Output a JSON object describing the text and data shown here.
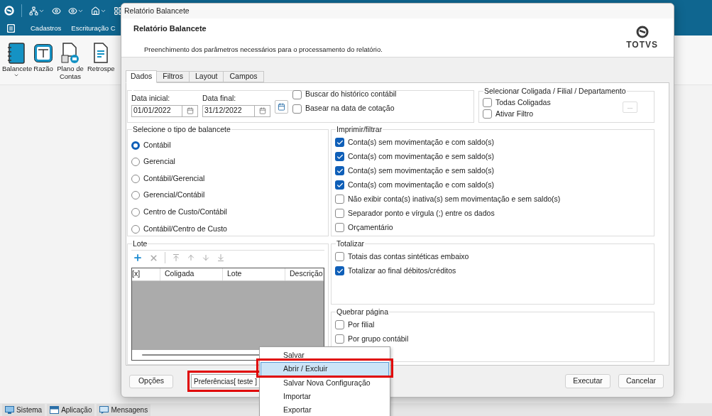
{
  "app": {
    "menu_items": [
      "Cadastros",
      "Escrituração C"
    ],
    "ribbon": [
      {
        "label": "Balancete",
        "kind": "book",
        "dropdown": true
      },
      {
        "label": "Razão",
        "kind": "ledger",
        "dropdown": false
      },
      {
        "label": "Plano de Contas",
        "kind": "chart",
        "dropdown": false
      },
      {
        "label": "Retrospe",
        "kind": "report",
        "dropdown": false
      }
    ],
    "status_tabs": [
      {
        "label": "Sistema",
        "kind": "monitor"
      },
      {
        "label": "Aplicação",
        "kind": "window"
      },
      {
        "label": "Mensagens",
        "kind": "message"
      }
    ]
  },
  "dialog": {
    "window_title": "Relatório Balancete",
    "header": {
      "title": "Relatório Balancete",
      "subtitle": "Preenchimento dos parâmetros necessários para o processamento do relatório.",
      "logo_text": "TOTVS"
    },
    "tabs": [
      {
        "label": "Dados",
        "selected": true
      },
      {
        "label": "Filtros",
        "selected": false
      },
      {
        "label": "Layout",
        "selected": false
      },
      {
        "label": "Campos",
        "selected": false
      }
    ],
    "period": {
      "start_label": "Data inicial:",
      "start_value": "01/01/2022",
      "end_label": "Data final:",
      "end_value": "31/12/2022",
      "options": [
        {
          "label": "Buscar do histórico contábil",
          "checked": false
        },
        {
          "label": "Basear na data de cotação",
          "checked": false
        }
      ]
    },
    "company_filter": {
      "title": "Selecionar Coligada / Filial / Departamento",
      "browse_button": "...",
      "options": [
        {
          "label": "Todas Coligadas",
          "checked": false
        },
        {
          "label": "Ativar Filtro",
          "checked": false
        }
      ]
    },
    "balance_type": {
      "title": "Selecione o tipo de balancete",
      "options": [
        {
          "label": "Contábil",
          "selected": true
        },
        {
          "label": "Gerencial",
          "selected": false
        },
        {
          "label": "Contábil/Gerencial",
          "selected": false
        },
        {
          "label": "Gerencial/Contábil",
          "selected": false
        },
        {
          "label": "Centro de Custo/Contábil",
          "selected": false
        },
        {
          "label": "Contábil/Centro de Custo",
          "selected": false
        }
      ]
    },
    "print_filter": {
      "title": "Imprimir/filtrar",
      "options": [
        {
          "label": "Conta(s) sem movimentação e com saldo(s)",
          "checked": true
        },
        {
          "label": "Conta(s) com movimentação e sem saldo(s)",
          "checked": true
        },
        {
          "label": "Conta(s) sem movimentação e sem saldo(s)",
          "checked": true
        },
        {
          "label": "Conta(s) com movimentação e com saldo(s)",
          "checked": true
        },
        {
          "label": "Não exibir conta(s) inativa(s) sem movimentação e sem saldo(s)",
          "checked": false
        },
        {
          "label": "Separador ponto e vírgula (;) entre os dados",
          "checked": false
        },
        {
          "label": "Orçamentário",
          "checked": false
        }
      ]
    },
    "batch": {
      "title": "Lote",
      "columns": [
        "[x]",
        "Coligada",
        "Lote",
        "Descrição"
      ]
    },
    "totals": {
      "title": "Totalizar",
      "options": [
        {
          "label": "Totais das contas sintéticas embaixo",
          "checked": false
        },
        {
          "label": "Totalizar ao final débitos/créditos",
          "checked": true
        }
      ]
    },
    "page_break": {
      "title": "Quebrar página",
      "options": [
        {
          "label": "Por filial",
          "checked": false
        },
        {
          "label": "Por grupo contábil",
          "checked": false
        }
      ]
    },
    "footer": {
      "options_button": "Opções",
      "preferences_button": {
        "label": "Preferências[ teste ]",
        "highlighted": true
      },
      "execute_button": "Executar",
      "cancel_button": "Cancelar"
    }
  },
  "context_menu": [
    {
      "label": "Salvar",
      "selected": false,
      "highlighted": false
    },
    {
      "label": "Abrir / Excluir",
      "selected": true,
      "highlighted": true
    },
    {
      "label": "Salvar Nova Configuração",
      "selected": false,
      "highlighted": false
    },
    {
      "label": "Importar",
      "selected": false,
      "highlighted": false
    },
    {
      "label": "Exportar",
      "selected": false,
      "highlighted": false
    }
  ]
}
